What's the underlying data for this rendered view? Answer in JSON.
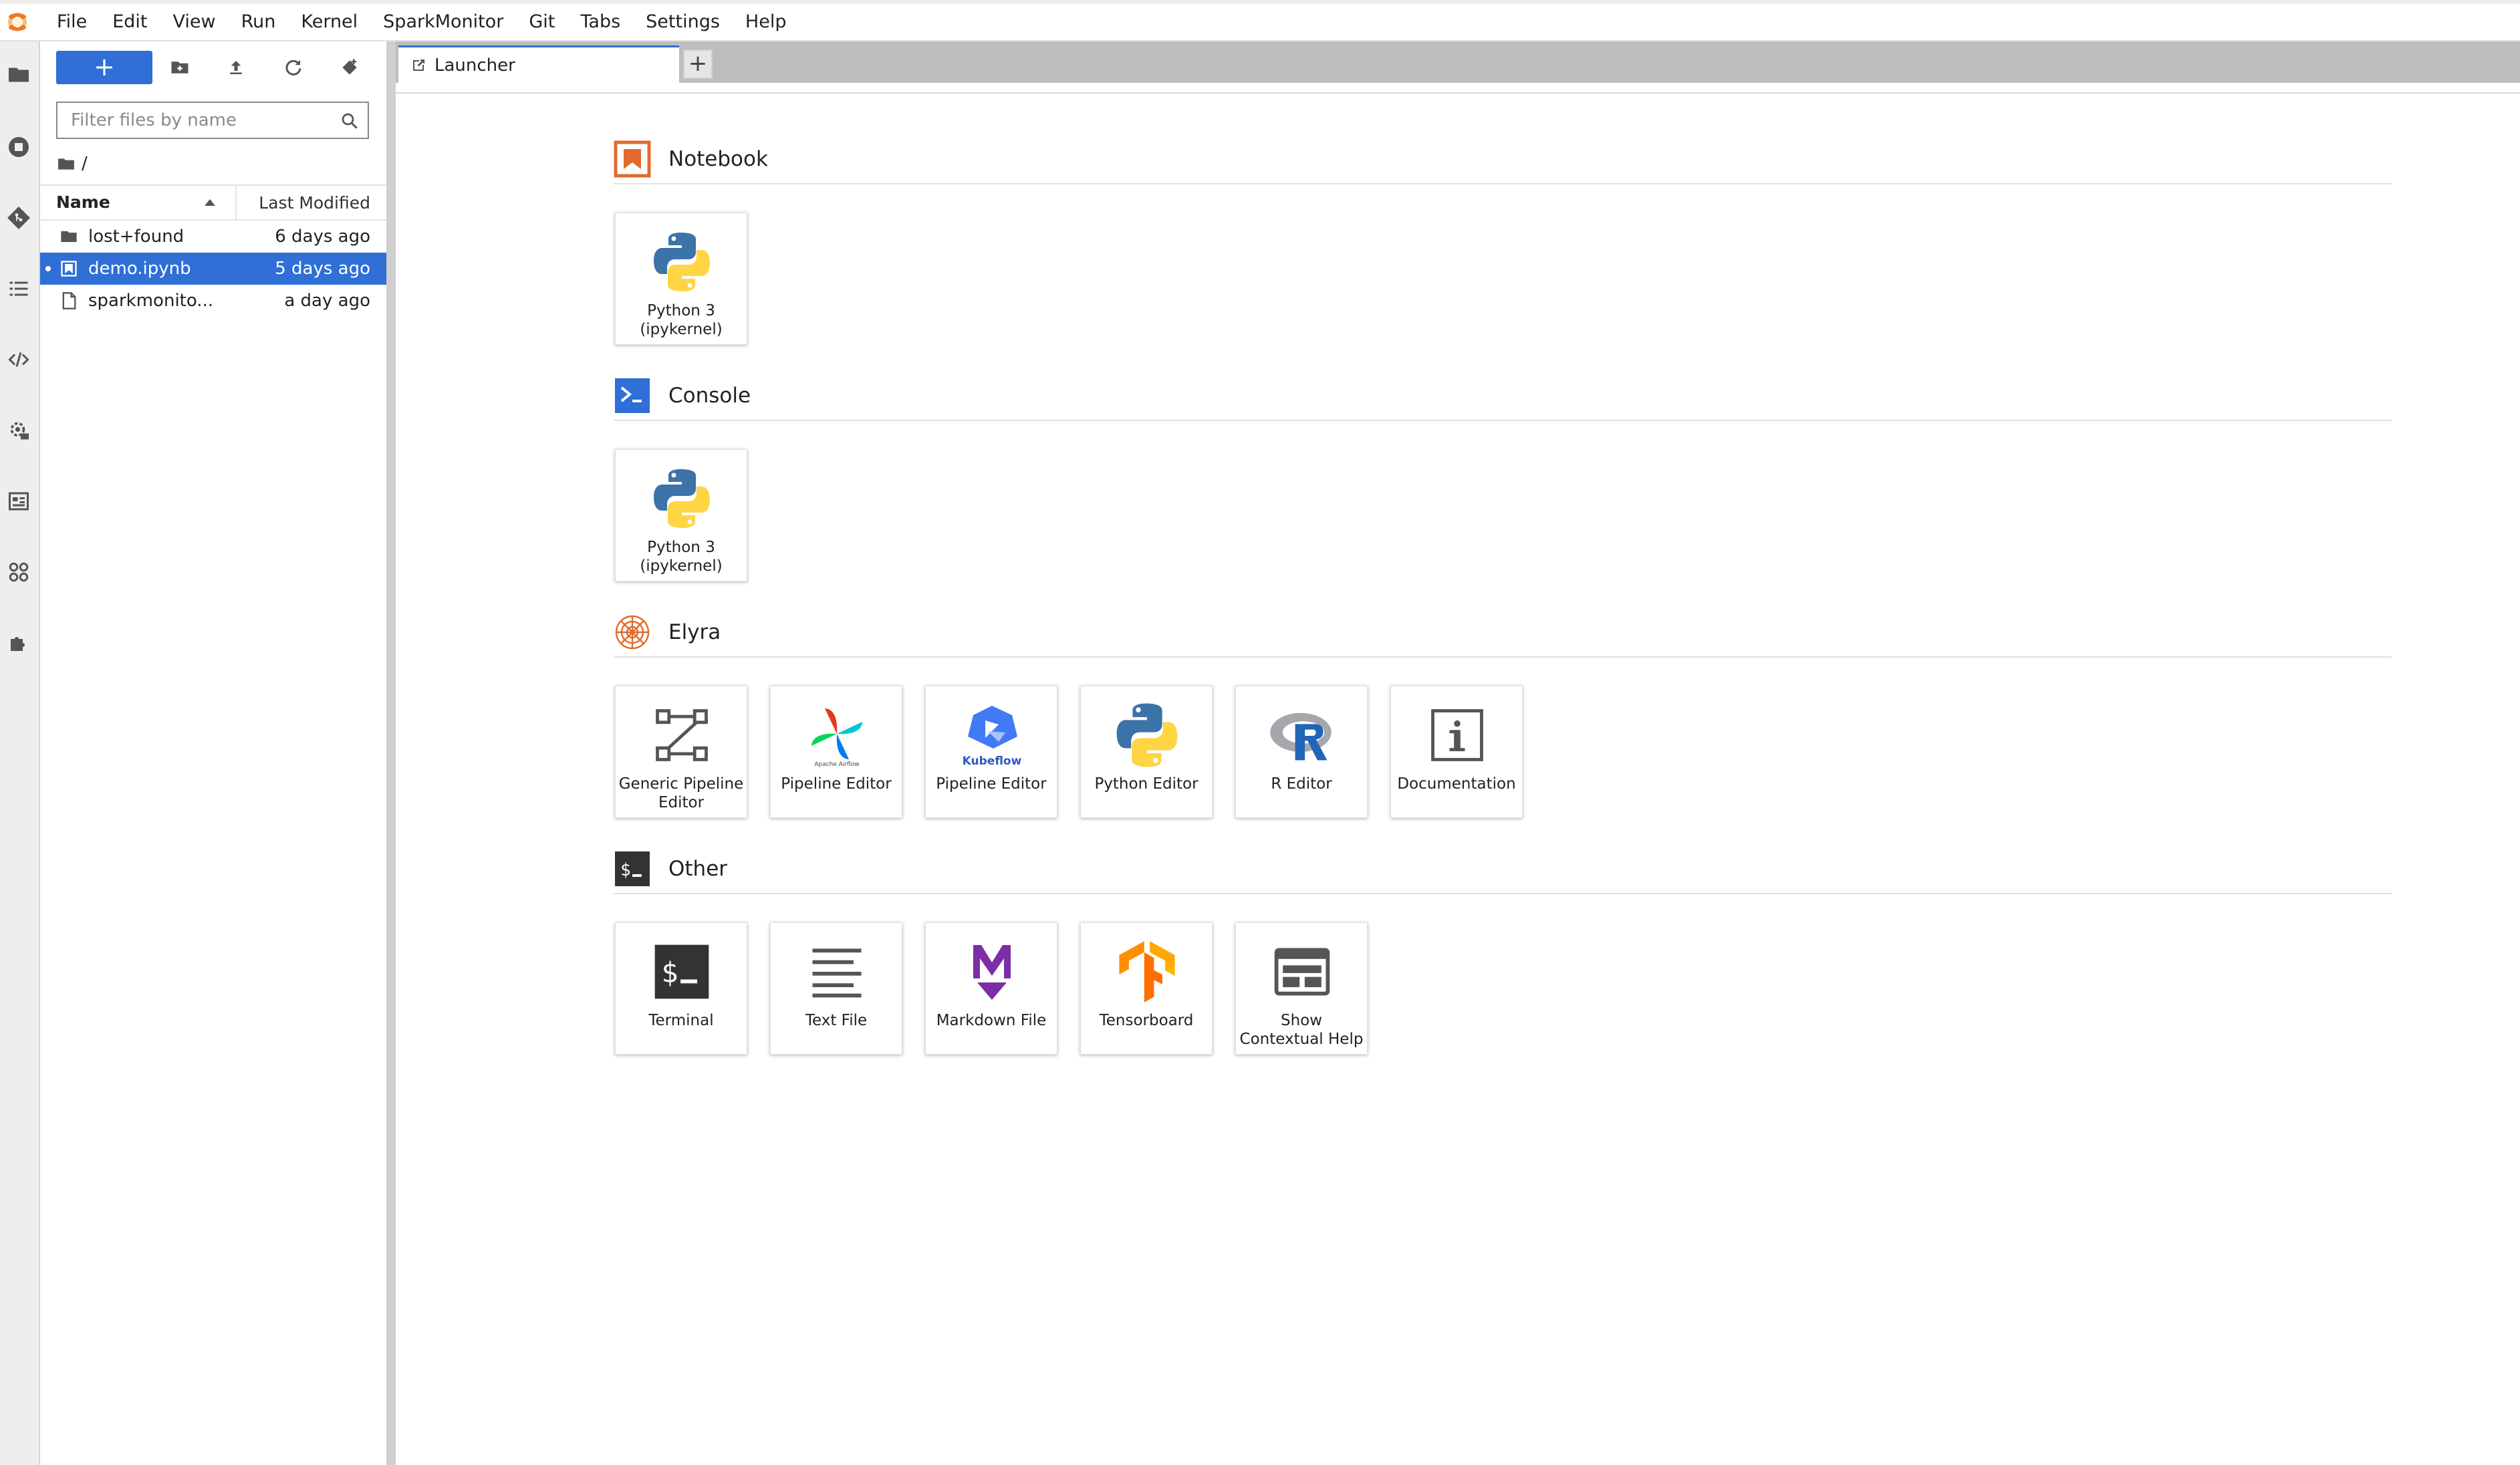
{
  "menubar": {
    "items": [
      "File",
      "Edit",
      "View",
      "Run",
      "Kernel",
      "SparkMonitor",
      "Git",
      "Tabs",
      "Settings",
      "Help"
    ]
  },
  "activity_bar": {
    "icons": [
      "folder-icon",
      "running-icon",
      "git-icon",
      "toc-icon",
      "code-snippet-icon",
      "runtimes-icon",
      "runtime-images-icon",
      "component-catalogs-icon",
      "extension-icon"
    ]
  },
  "file_browser": {
    "new_label": "+",
    "filter_placeholder": "Filter files by name",
    "breadcrumb": "/",
    "columns": {
      "name": "Name",
      "modified": "Last Modified"
    },
    "files": [
      {
        "name": "lost+found",
        "modified": "6 days ago",
        "icon": "folder-icon",
        "selected": false
      },
      {
        "name": "demo.ipynb",
        "modified": "5 days ago",
        "icon": "notebook-icon",
        "selected": true
      },
      {
        "name": "sparkmonito...",
        "modified": "a day ago",
        "icon": "file-icon",
        "selected": false
      }
    ]
  },
  "tabs": {
    "active": "Launcher",
    "add_label": "+"
  },
  "launcher": {
    "sections": [
      {
        "title": "Notebook",
        "cards": [
          {
            "label": "Python 3 (ipykernel)"
          }
        ]
      },
      {
        "title": "Console",
        "cards": [
          {
            "label": "Python 3 (ipykernel)"
          }
        ]
      },
      {
        "title": "Elyra",
        "cards": [
          {
            "label": "Generic Pipeline Editor"
          },
          {
            "label": "Pipeline Editor",
            "caption": "Apache Airflow"
          },
          {
            "label": "Pipeline Editor",
            "caption": "Kubeflow"
          },
          {
            "label": "Python Editor"
          },
          {
            "label": "R Editor"
          },
          {
            "label": "Documentation"
          }
        ]
      },
      {
        "title": "Other",
        "cards": [
          {
            "label": "Terminal"
          },
          {
            "label": "Text File"
          },
          {
            "label": "Markdown File"
          },
          {
            "label": "Tensorboard"
          },
          {
            "label": "Show Contextual Help"
          }
        ]
      }
    ]
  },
  "colors": {
    "accent": "#2f6fd6",
    "notebook_orange": "#e16b2f",
    "console_blue": "#2f6fd6",
    "markdown_purple": "#7b2ea5"
  }
}
